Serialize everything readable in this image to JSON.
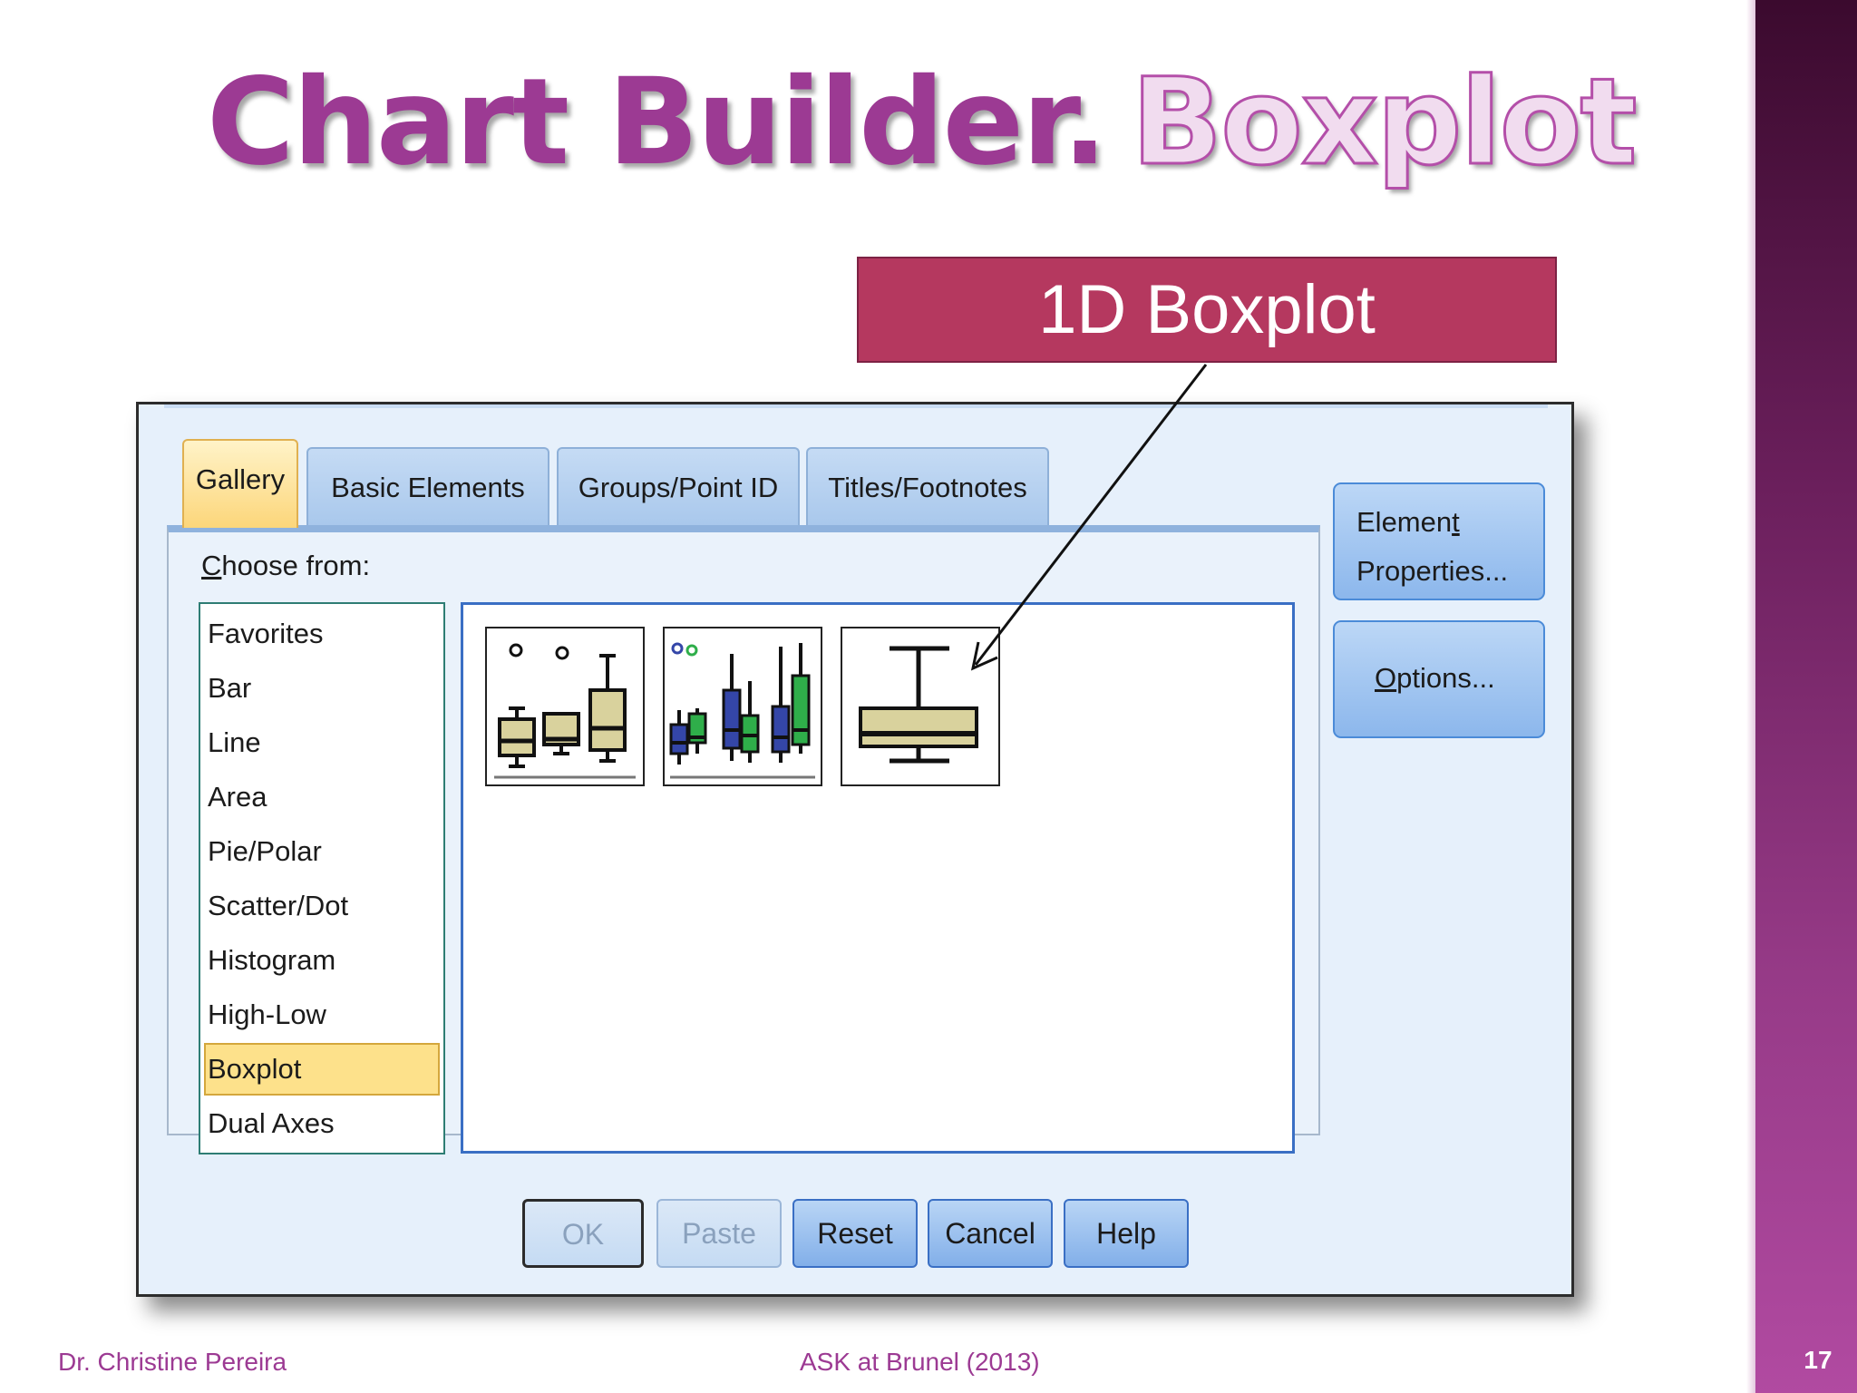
{
  "slide": {
    "title_main": "Chart Builder.",
    "title_accent": "Boxplot",
    "callout": "1D Boxplot",
    "footer_left": "Dr. Christine Pereira",
    "footer_center": "ASK at Brunel (2013)",
    "page_number": "17"
  },
  "dialog": {
    "tabs": [
      {
        "label": "Gallery",
        "active": true
      },
      {
        "label": "Basic Elements",
        "active": false
      },
      {
        "label": "Groups/Point ID",
        "active": false
      },
      {
        "label": "Titles/Footnotes",
        "active": false
      }
    ],
    "choose_label_first": "C",
    "choose_label_rest": "hoose from:",
    "categories": [
      "Favorites",
      "Bar",
      "Line",
      "Area",
      "Pie/Polar",
      "Scatter/Dot",
      "Histogram",
      "High-Low",
      "Boxplot",
      "Dual Axes"
    ],
    "selected_category": "Boxplot",
    "gallery_items": [
      "simple-boxplot",
      "clustered-boxplot",
      "1d-boxplot"
    ],
    "side_buttons": {
      "element_properties_line1_a": "Elemen",
      "element_properties_line1_b": "t",
      "element_properties_line2": "Properties...",
      "options_a": "O",
      "options_b": "ptions..."
    },
    "bottom_buttons": [
      {
        "label": "OK",
        "enabled": false
      },
      {
        "label": "Paste",
        "enabled": false
      },
      {
        "label": "Reset",
        "enabled": true
      },
      {
        "label": "Cancel",
        "enabled": true
      },
      {
        "label": "Help",
        "enabled": true
      }
    ]
  },
  "colors": {
    "title_purple": "#9c3a93",
    "callout_red": "#b5385f",
    "selection_yellow": "#fde18b",
    "box_fill": "#d9d29d",
    "series_blue": "#3446a8",
    "series_green": "#2fae4a"
  }
}
